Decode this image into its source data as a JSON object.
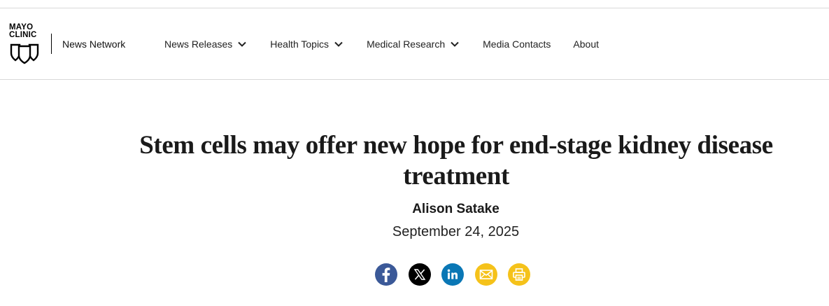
{
  "brand": {
    "logo_line1": "MAYO",
    "logo_line2": "CLINIC",
    "network_name": "News Network"
  },
  "nav": {
    "items": [
      {
        "label": "News Releases",
        "has_dropdown": true
      },
      {
        "label": "Health Topics",
        "has_dropdown": true
      },
      {
        "label": "Medical Research",
        "has_dropdown": true
      },
      {
        "label": "Media Contacts",
        "has_dropdown": false
      },
      {
        "label": "About",
        "has_dropdown": false
      }
    ]
  },
  "article": {
    "title": "Stem cells may offer new hope for end-stage kidney disease treatment",
    "author": "Alison Satake",
    "date": "September 24, 2025"
  },
  "share": {
    "buttons": [
      {
        "icon": "facebook-icon",
        "color": "#3b5998"
      },
      {
        "icon": "x-icon",
        "color": "#000000"
      },
      {
        "icon": "linkedin-icon",
        "color": "#0a77b5"
      },
      {
        "icon": "email-icon",
        "color": "#f5c21a"
      },
      {
        "icon": "print-icon",
        "color": "#f5c21a"
      }
    ]
  },
  "colors": {
    "divider": "#d8d8d8",
    "text": "#1a1a1a"
  }
}
